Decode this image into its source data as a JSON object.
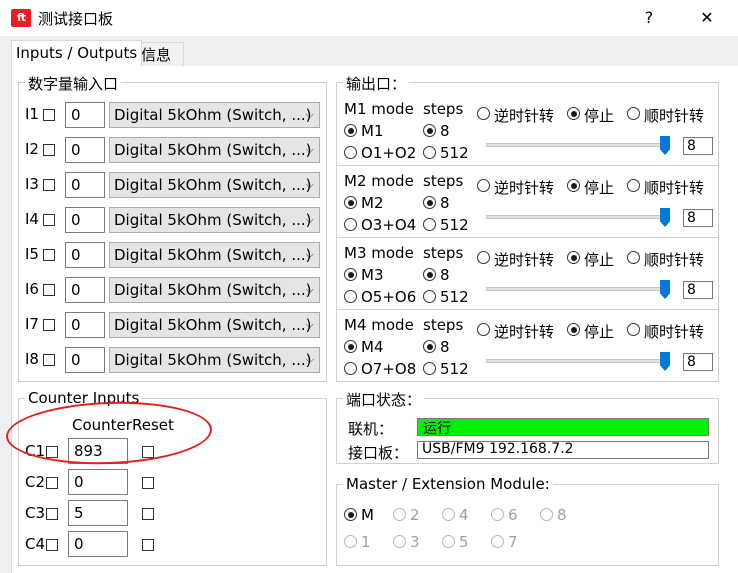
{
  "window": {
    "title": "测试接口板",
    "help_label": "?",
    "close_label": "✕",
    "icon_text": "ft"
  },
  "tabs": [
    {
      "label": "Inputs / Outputs",
      "active": true
    },
    {
      "label": "信息",
      "active": false
    }
  ],
  "digital_inputs": {
    "title": "数字量输入口",
    "rows": [
      {
        "label": "I1",
        "value": "0",
        "mode": "Digital 5kOhm (Switch, ...)"
      },
      {
        "label": "I2",
        "value": "0",
        "mode": "Digital 5kOhm (Switch, ...)"
      },
      {
        "label": "I3",
        "value": "0",
        "mode": "Digital 5kOhm (Switch, ...)"
      },
      {
        "label": "I4",
        "value": "0",
        "mode": "Digital 5kOhm (Switch, ...)"
      },
      {
        "label": "I5",
        "value": "0",
        "mode": "Digital 5kOhm (Switch, ...)"
      },
      {
        "label": "I6",
        "value": "0",
        "mode": "Digital 5kOhm (Switch, ...)"
      },
      {
        "label": "I7",
        "value": "0",
        "mode": "Digital 5kOhm (Switch, ...)"
      },
      {
        "label": "I8",
        "value": "0",
        "mode": "Digital 5kOhm (Switch, ...)"
      }
    ]
  },
  "outputs": {
    "title": "输出口：",
    "motors": [
      {
        "mode_label": "M1 mode",
        "steps_label": "steps",
        "opt_a": "M1",
        "opt_b": "O1+O2",
        "step_a": "8",
        "step_b": "512",
        "ccw": "逆时针转",
        "stop": "停止",
        "cw": "顺时针转",
        "value": "8",
        "level": 1.0
      },
      {
        "mode_label": "M2 mode",
        "steps_label": "steps",
        "opt_a": "M2",
        "opt_b": "O3+O4",
        "step_a": "8",
        "step_b": "512",
        "ccw": "逆时针转",
        "stop": "停止",
        "cw": "顺时针转",
        "value": "8",
        "level": 1.0
      },
      {
        "mode_label": "M3 mode",
        "steps_label": "steps",
        "opt_a": "M3",
        "opt_b": "O5+O6",
        "step_a": "8",
        "step_b": "512",
        "ccw": "逆时针转",
        "stop": "停止",
        "cw": "顺时针转",
        "value": "8",
        "level": 1.0
      },
      {
        "mode_label": "M4 mode",
        "steps_label": "steps",
        "opt_a": "M4",
        "opt_b": "O7+O8",
        "step_a": "8",
        "step_b": "512",
        "ccw": "逆时针转",
        "stop": "停止",
        "cw": "顺时针转",
        "value": "8",
        "level": 1.0
      }
    ]
  },
  "counters": {
    "title": "Counter Inputs",
    "col_counter": "Counter",
    "col_reset": "Reset",
    "rows": [
      {
        "label": "C1",
        "value": "893"
      },
      {
        "label": "C2",
        "value": "0"
      },
      {
        "label": "C3",
        "value": "5"
      },
      {
        "label": "C4",
        "value": "0"
      }
    ]
  },
  "port_status": {
    "title": "端口状态：",
    "link_label": "联机：",
    "link_value": "运行",
    "board_label": "接口板：",
    "board_value": "USB/FM9 192.168.7.2",
    "status_color": "#00f000"
  },
  "extension": {
    "title": "Master / Extension Module:",
    "options": [
      "M",
      "2",
      "4",
      "6",
      "8",
      "1",
      "3",
      "5",
      "7"
    ]
  },
  "annotation_color": "#e02020"
}
